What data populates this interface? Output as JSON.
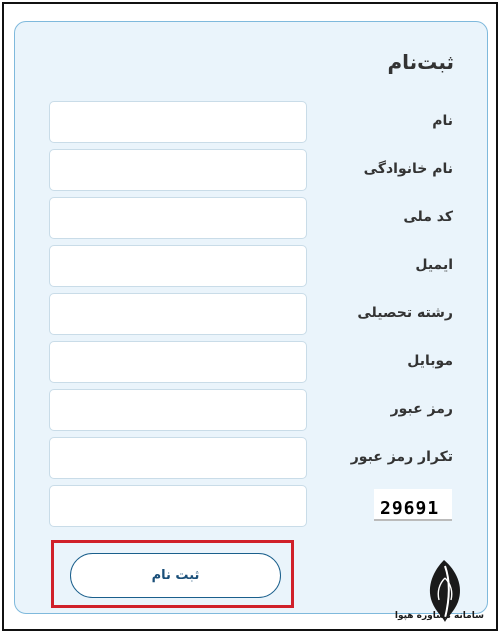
{
  "form": {
    "title": "ثبت‌نام",
    "fields": [
      {
        "label": "نام",
        "value": ""
      },
      {
        "label": "نام خانوادگی",
        "value": ""
      },
      {
        "label": "کد ملی",
        "value": ""
      },
      {
        "label": "ایمیل",
        "value": ""
      },
      {
        "label": "رشته تحصیلی",
        "value": ""
      },
      {
        "label": "موبایل",
        "value": ""
      },
      {
        "label": "رمز عبور",
        "value": ""
      },
      {
        "label": "تکرار رمز عبور",
        "value": ""
      }
    ],
    "captcha": {
      "code": "29691",
      "value": ""
    },
    "submit_label": "ثبت نام"
  },
  "watermark": {
    "text": "سامانه مشاوره هپوا"
  },
  "colors": {
    "card_background": "#eaf4fb",
    "card_border": "#7fb9dc",
    "button_text": "#1a4f79",
    "highlight_border": "#d0202a"
  }
}
